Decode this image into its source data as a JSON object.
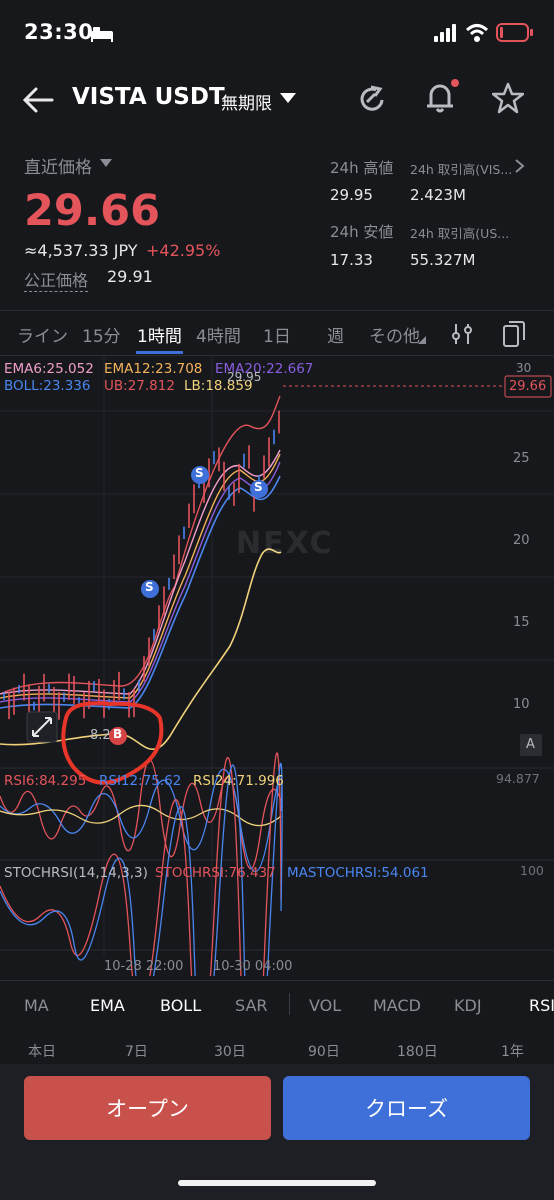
{
  "status_bar": {
    "time": "23:30"
  },
  "header": {
    "symbol": "VISTA USDT",
    "contract": "無期限"
  },
  "ticker": {
    "last_price_label": "直近価格",
    "last_price": "29.66",
    "jpy_value": "≈4,537.33 JPY",
    "change": "+42.95%",
    "fair_price_label": "公正価格",
    "fair_price": "29.91",
    "high_label": "24h 高値",
    "high": "29.95",
    "volume_base_label": "24h 取引高(VIS...",
    "volume_base": "2.423M",
    "low_label": "24h 安値",
    "low": "17.33",
    "volume_quote_label": "24h 取引高(US...",
    "volume_quote": "55.327M"
  },
  "timeframes": [
    "ライン",
    "15分",
    "1時間",
    "4時間",
    "1日",
    "週",
    "その他"
  ],
  "active_timeframe_index": 2,
  "chart": {
    "ema6": "EMA6:25.052",
    "ema12": "EMA12:23.708",
    "ema20": "EMA20:22.667",
    "boll": "BOLL:23.336",
    "ub": "UB:27.812",
    "lb": "LB:18.859",
    "high_marker": "29.95",
    "low_marker": "8.2",
    "current_price_tag": "29.66",
    "y_ticks": [
      "30",
      "25",
      "20",
      "15",
      "10"
    ],
    "watermark": "NEXC",
    "signal_s": "S",
    "signal_b": "B",
    "a_button": "A",
    "x_labels": [
      "10-28 22:00",
      "10-30 04:00"
    ]
  },
  "rsi": {
    "rsi6": "RSI6:84.295",
    "rsi12": "RSI12:75.62",
    "rsi24": "RSI24:71.996",
    "max": "94.877"
  },
  "stochrsi": {
    "params": "STOCHRSI(14,14,3,3)",
    "value": "STOCHRSI:76.437",
    "ma": "MASTOCHRSI:54.061",
    "max": "100"
  },
  "indicators": [
    "MA",
    "EMA",
    "BOLL",
    "SAR",
    "VOL",
    "MACD",
    "KDJ",
    "RSI"
  ],
  "ranges": [
    "本日",
    "7日",
    "30日",
    "90日",
    "180日",
    "1年"
  ],
  "actions": {
    "open": "オープン",
    "close": "クローズ"
  },
  "colors": {
    "up": "#e3545b",
    "open_button": "#c9514c",
    "close_button": "#3f6fd8",
    "ema6": "#ef9fc9",
    "ema12": "#f2b25a",
    "ema20": "#8a5ee0",
    "boll": "#4a86f0",
    "ub": "#e3545b",
    "lb": "#f0d27a"
  }
}
